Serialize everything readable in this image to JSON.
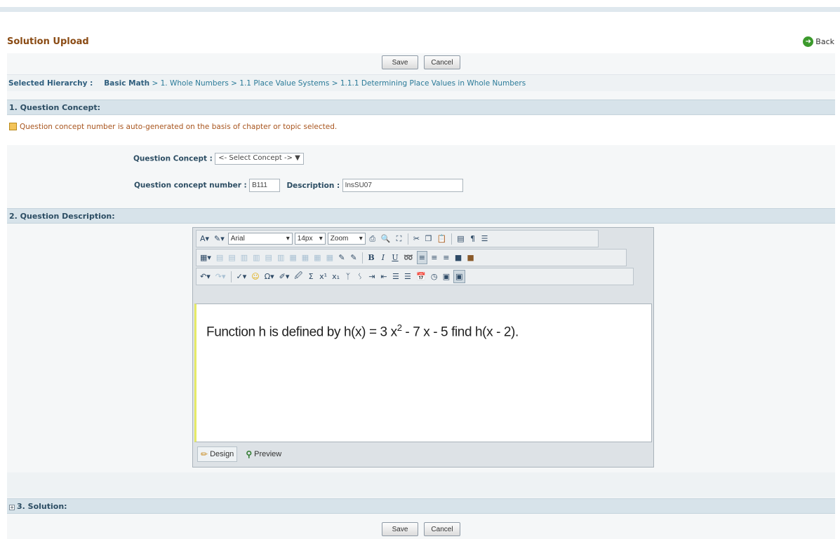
{
  "header": {
    "title": "Solution Upload",
    "back_label": "Back",
    "back_icon": "back-circle-arrow"
  },
  "actions": {
    "save_label": "Save",
    "cancel_label": "Cancel"
  },
  "hierarchy": {
    "label": "Selected Hierarchy :",
    "root": "Basic Math",
    "path": " > 1. Whole Numbers > 1.1 Place Value Systems > 1.1.1 Determining Place Values in Whole Numbers"
  },
  "section1": {
    "title": "1. Question Concept:",
    "notice": "Question concept number is auto-generated on the basis of chapter or topic selected.",
    "concept_label": "Question Concept :",
    "concept_selected": "<- Select Concept ->",
    "number_label": "Question concept number :",
    "number_value": "B111",
    "description_label": "Description :",
    "description_value": "InsSU07"
  },
  "section2": {
    "title": "2. Question Description:",
    "toolbar": {
      "font_name": "Arial",
      "font_size": "14px",
      "zoom": "Zoom",
      "bold": "B",
      "italic": "I",
      "underline": "U"
    },
    "editor_content": {
      "prefix": "Function h is defined by    h(x) = 3 x",
      "exponent": "2",
      "suffix": " - 7 x - 5    find h(x - 2)."
    },
    "tabs": {
      "design": "Design",
      "preview": "Preview"
    }
  },
  "section3": {
    "title": "3. Solution:"
  },
  "colors": {
    "title": "#8a4b14",
    "section_bg": "#d7e3ea",
    "link": "#2a7a98",
    "accent_green": "#3c9a2c"
  }
}
